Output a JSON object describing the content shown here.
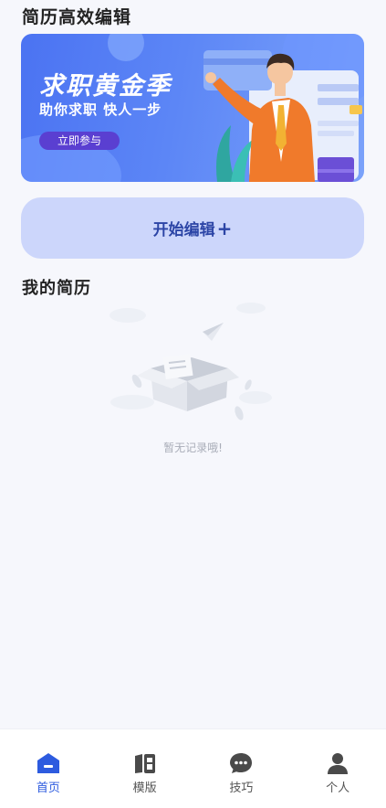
{
  "header": {
    "title": "简历高效编辑"
  },
  "banner": {
    "headline": "求职黄金季",
    "subline": "助你求职  快人一步",
    "cta_label": "立即参与"
  },
  "start_edit": {
    "label": "开始编辑",
    "icon_glyph": "+"
  },
  "my_resume": {
    "title": "我的简历",
    "empty_text": "暂无记录哦!"
  },
  "tabbar": {
    "active_color": "#2d5bdf",
    "inactive_color": "#555555",
    "items": [
      {
        "label": "首页",
        "icon": "home-icon",
        "active": true
      },
      {
        "label": "模版",
        "icon": "template-icon",
        "active": false
      },
      {
        "label": "技巧",
        "icon": "chat-bubble-icon",
        "active": false
      },
      {
        "label": "个人",
        "icon": "person-icon",
        "active": false
      }
    ]
  }
}
